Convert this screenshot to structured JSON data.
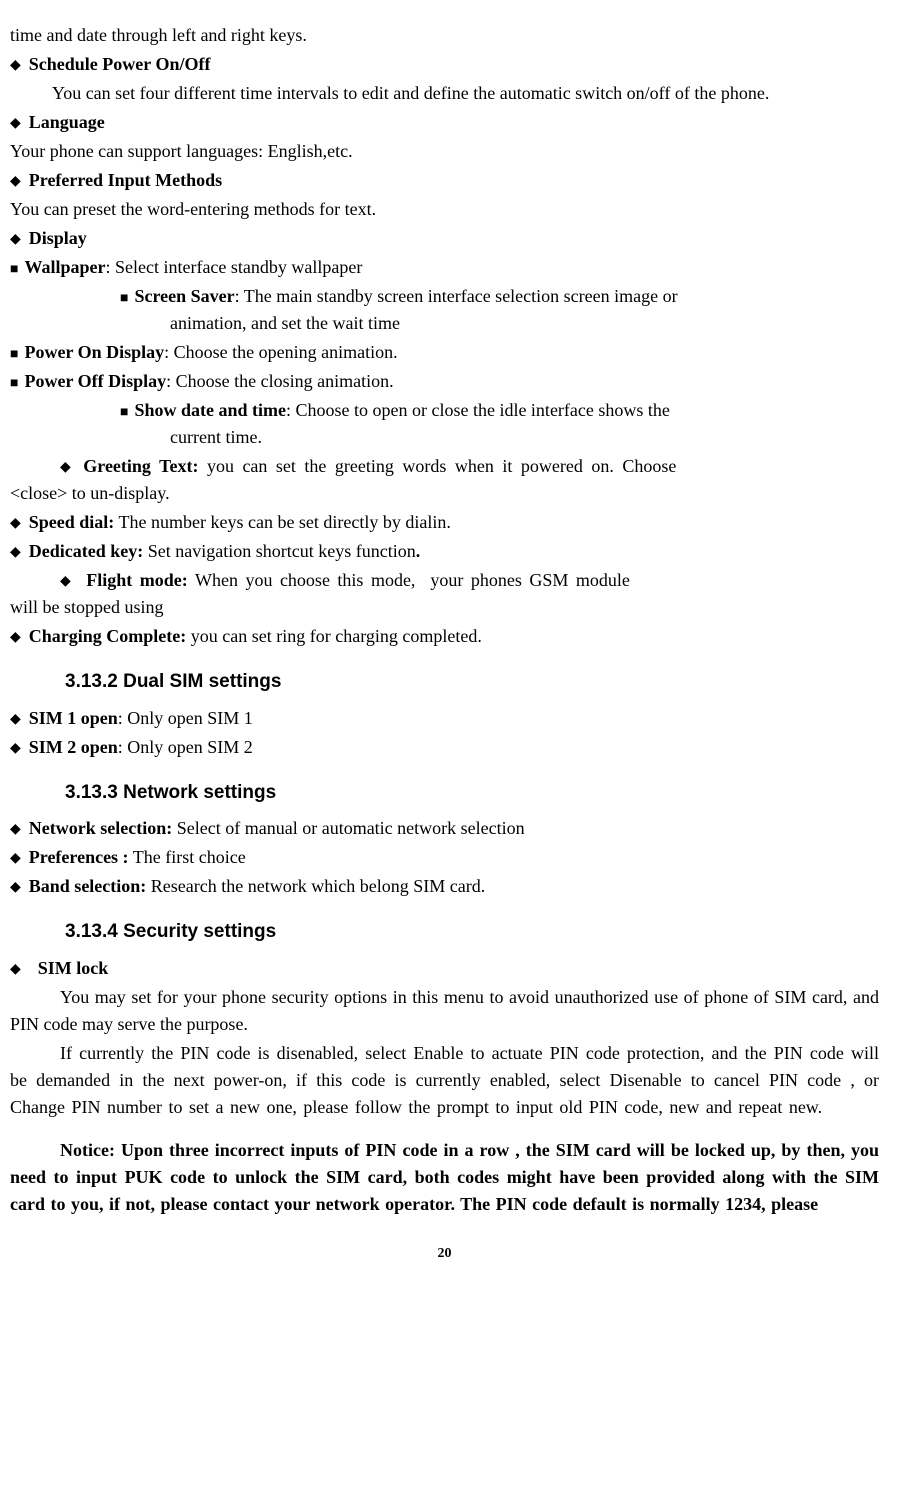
{
  "top_line": "time and date through left and right keys.",
  "items": [
    {
      "head": "Schedule Power On/Off",
      "body": "You can set four different time intervals to edit and define the automatic switch on/off of the phone.",
      "noindent": true
    },
    {
      "head": "Language",
      "body": "Your phone can support languages: English,etc."
    },
    {
      "head": "Preferred Input Methods",
      "body": "You can preset the word-entering methods for text."
    },
    {
      "head": "Display"
    }
  ],
  "display_sub": [
    {
      "head": "Wallpaper",
      "tail": ": Select interface standby wallpaper"
    },
    {
      "head": "Screen Saver",
      "tail": ": The main standby screen interface selection screen image or animation, and set the wait time"
    },
    {
      "head": "Power On Display",
      "tail": ": Choose the opening animation."
    },
    {
      "head": "Power Off Display",
      "tail": ": Choose the closing animation."
    },
    {
      "head": "Show date and time",
      "tail": ": Choose to open or close the idle interface shows the current time."
    }
  ],
  "items2": [
    {
      "head": "Greeting Text:",
      "sep": " ",
      "tail": "you can set the greeting words when it powered on. Choose <close> to un-display.",
      "justify_wide": true
    },
    {
      "head": "Speed dial:",
      "sep": " ",
      "tail": "The number keys can be set directly by dialin."
    },
    {
      "head": "Dedicated key:",
      "sep": " ",
      "tail": "Set navigation shortcut keys function.",
      "trail_bold": true
    },
    {
      "head": "Flight mode:",
      "sep": " ",
      "tail": "When you choose this mode,   your phones GSM module will be stopped using",
      "justify_medium": true
    },
    {
      "head": "Charging Complete:",
      "sep": " ",
      "tail": "you can set ring for charging completed."
    }
  ],
  "heading2": "3.13.2 Dual SIM settings",
  "dual_sim": [
    {
      "head": "SIM 1 open",
      "tail": ": Only open SIM 1"
    },
    {
      "head": "SIM 2 open",
      "tail": ": Only open SIM 2"
    }
  ],
  "heading3": "3.13.3 Network settings",
  "network": [
    {
      "head": "Network selection:",
      "sep": " ",
      "tail": "Select of manual or automatic network selection"
    },
    {
      "head": "Preferences :",
      "sep": " ",
      "tail": "The first choice"
    },
    {
      "head": "Band selection:",
      "sep": " ",
      "tail": "Research the network which belong SIM card."
    }
  ],
  "heading4": "3.13.4 Security settings",
  "simlock_head": "SIM lock",
  "simlock_p1": "You may set for your phone security options in this menu to avoid unauthorized use of phone of SIM card, and PIN code may serve the purpose.",
  "simlock_p2": "If currently the PIN code is disenabled, select Enable to actuate PIN code protection, and the PIN code will be demanded in the next power-on, if this code is currently enabled, select Disenable to cancel PIN code , or Change PIN number to set a new one, please follow the prompt to input old PIN code, new and repeat new.",
  "notice": "Notice: Upon three incorrect inputs of PIN code in a row , the SIM card will be locked up, by then, you need to input PUK code to unlock the SIM card, both codes might have been provided along with the SIM card to you, if not, please contact your network operator. The PIN code default is normally 1234, please",
  "page_number": "20"
}
